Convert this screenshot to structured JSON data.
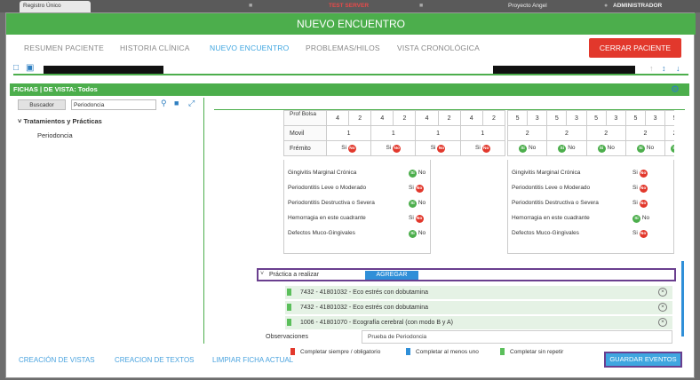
{
  "topbar": {
    "tab": "Registro Único",
    "server": "TEST SERVER",
    "project": "Proyecto Angel",
    "user": "ADMINISTRADOR"
  },
  "header": {
    "title": "NUEVO ENCUENTRO"
  },
  "nav": {
    "tabs": [
      "RESUMEN PACIENTE",
      "HISTORIA CLÍNICA",
      "NUEVO ENCUENTRO",
      "PROBLEMAS/HILOS",
      "VISTA CRONOLÓGICA"
    ],
    "active": "NUEVO ENCUENTRO",
    "close_label": "CERRAR PACIENTE"
  },
  "fichas": {
    "title": "FICHAS | DE VISTA: Todos"
  },
  "left": {
    "search_label": "Buscador",
    "search_value": "Periodoncia",
    "tree": {
      "group": "Tratamientos y Prácticas",
      "item": "Periodoncia"
    }
  },
  "grid": {
    "rows": [
      "Prof Bolsa",
      "Movil",
      "Frémito"
    ],
    "left": {
      "prof": [
        "4",
        "2",
        "4",
        "2",
        "4",
        "2",
        "4",
        "2"
      ],
      "movil": [
        "1",
        "1",
        "1",
        "1"
      ],
      "fremito_yes": "Si",
      "fremito_no": "No"
    },
    "right": {
      "prof": [
        "5",
        "3",
        "5",
        "3",
        "5",
        "3",
        "5",
        "3",
        "5"
      ],
      "movil": [
        "2",
        "2",
        "2",
        "2",
        "2"
      ],
      "fremito_yes": "Si",
      "fremito_no": "No"
    },
    "conditions": [
      "Gingivitis Marginal Crónica",
      "Periodontitis Leve o Moderado",
      "Periodontitis Destructiva o Severa",
      "Hemorragia en este cuadrante",
      "Defectos Muco-Gingivales"
    ]
  },
  "practica": {
    "label": "Práctica a realizar",
    "add_label": "AGREGAR"
  },
  "items": [
    "7432 - 41801032 - Eco estrés con dobutamina",
    "7432 - 41801032 - Eco estrés con dobutamina",
    "1006 - 41801070 - Ecografía cerebral (con modo B y A)"
  ],
  "observaciones": {
    "label": "Observaciones",
    "value": "Prueba de Periodoncia"
  },
  "legend": [
    {
      "label": "Completar siempre / obligatorio",
      "color": "#e2382c"
    },
    {
      "label": "Completar al menos uno",
      "color": "#2f8fd8"
    },
    {
      "label": "Completar sin repetir",
      "color": "#5bbf5b"
    }
  ],
  "footer": {
    "links": [
      "CREACIÓN DE VISTAS",
      "CREACION DE TEXTOS",
      "LIMPIAR FICHA ACTUAL"
    ],
    "save_label": "GUARDAR EVENTOS"
  }
}
